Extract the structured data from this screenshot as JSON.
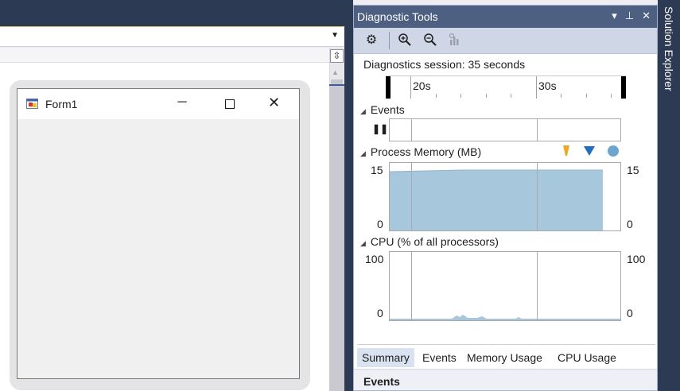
{
  "form": {
    "title": "Form1"
  },
  "diagnostic_tools": {
    "title": "Diagnostic Tools",
    "session": "Diagnostics session: 35 seconds",
    "ruler_labels": [
      "20s",
      "30s"
    ],
    "events_header": "Events",
    "memory_header": "Process Memory (MB)",
    "memory_axis": {
      "top": "15",
      "bottom": "0"
    },
    "memory_level": 0.9,
    "cpu_header": "CPU (% of all processors)",
    "cpu_axis": {
      "top": "100",
      "bottom": "0"
    },
    "tabs": [
      "Summary",
      "Events",
      "Memory Usage",
      "CPU Usage"
    ],
    "active_tab": "Summary",
    "bottom_header": "Events",
    "marker_colors": {
      "gc": "#f3a81b",
      "snapshot": "#1e6fc4",
      "circle": "#6aa6d0"
    },
    "fill_color": "#a7c8dc"
  },
  "solution_explorer": {
    "label": "Solution Explorer"
  }
}
